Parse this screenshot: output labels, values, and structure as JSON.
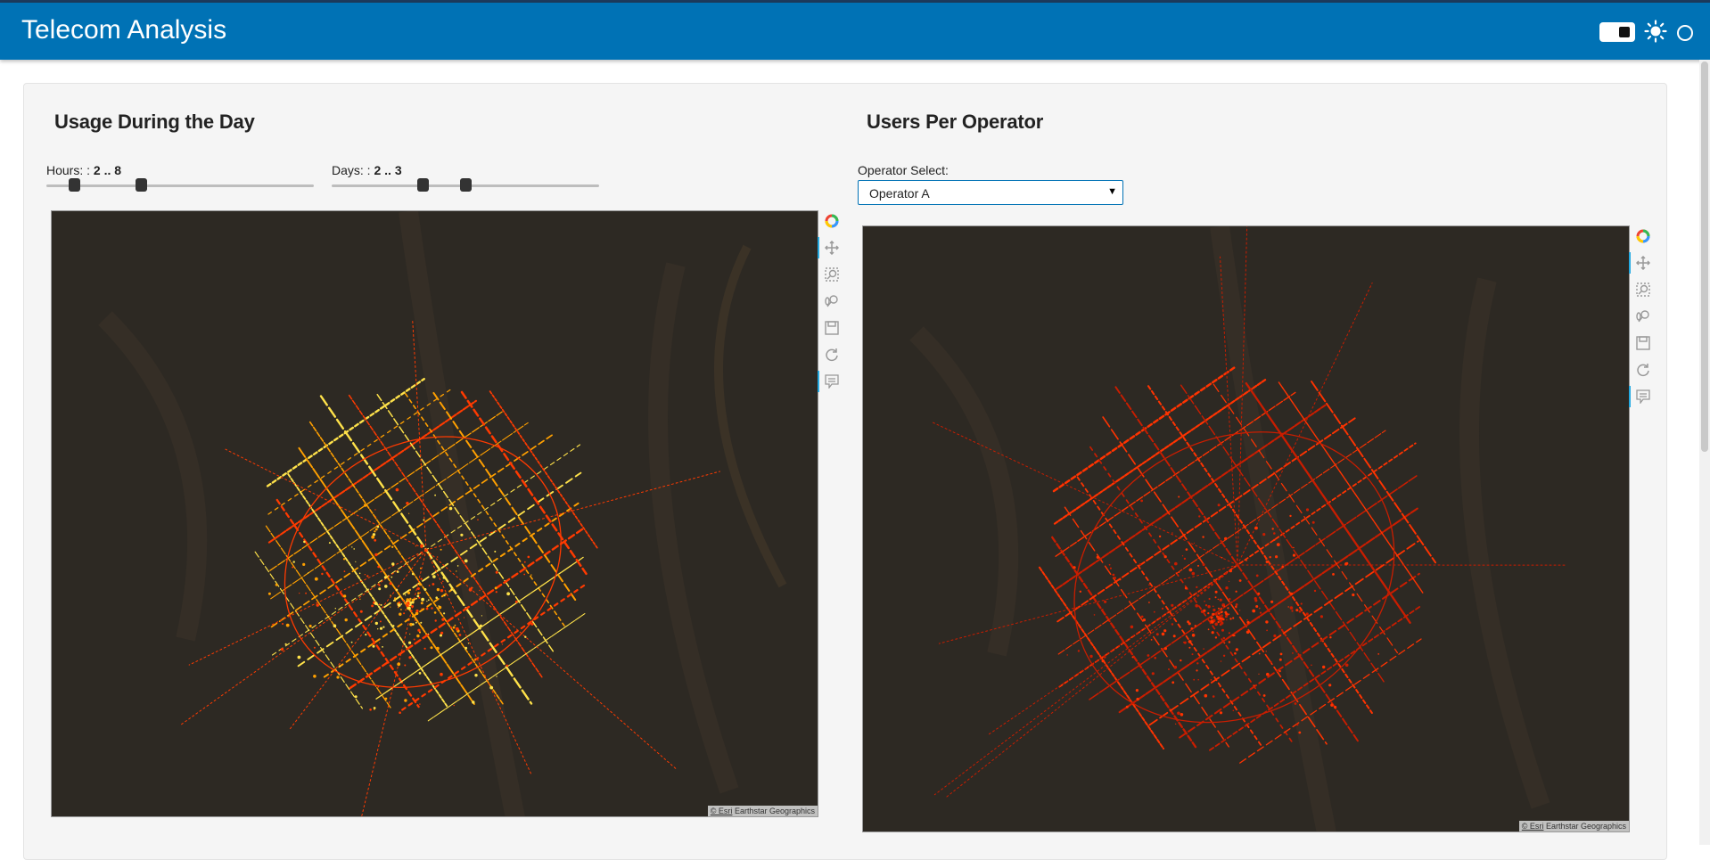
{
  "app": {
    "title": "Telecom Analysis"
  },
  "header": {
    "icons": [
      "theme-toggle",
      "sun-icon",
      "circle-icon"
    ]
  },
  "left_panel": {
    "title": "Usage During the Day",
    "hours_slider": {
      "label": "Hours: :",
      "value": "2 .. 8",
      "low": 2,
      "high": 8,
      "min": 0,
      "max": 23
    },
    "days_slider": {
      "label": "Days: :",
      "value": "2 .. 3",
      "low": 2,
      "high": 3,
      "min": 0,
      "max": 6
    },
    "map_attribution": {
      "esri": "© Esri",
      "text": "Earthstar Geographics"
    },
    "heat_colors": [
      "#ff3a00",
      "#ffa000",
      "#ffe24a"
    ]
  },
  "right_panel": {
    "title": "Users Per Operator",
    "select_label": "Operator Select:",
    "select_value": "Operator A",
    "map_attribution": {
      "esri": "© Esri",
      "text": "Earthstar Geographics"
    },
    "heat_colors": [
      "#c91d00",
      "#ff3300"
    ]
  },
  "toolbar_icons": [
    "bokeh-logo-icon",
    "pan-icon",
    "box-zoom-icon",
    "wheel-zoom-icon",
    "save-icon",
    "reset-icon",
    "hover-icon"
  ],
  "colors": {
    "header": "#0072b5",
    "map_bg": "#2d2923",
    "accent": "#26aae1"
  }
}
